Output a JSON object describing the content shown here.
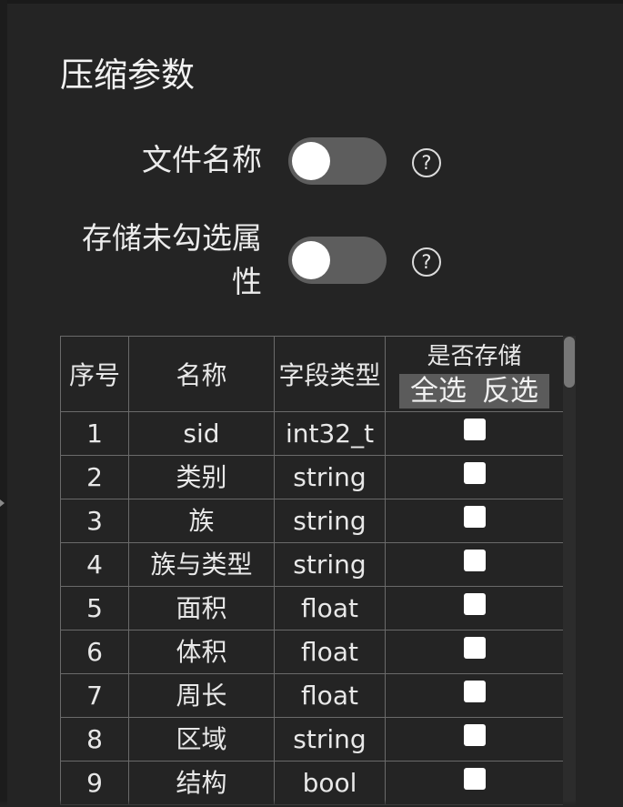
{
  "section": {
    "title": "压缩参数"
  },
  "settings": [
    {
      "label": "文件名称",
      "toggle": "off",
      "help": "?"
    },
    {
      "label": "存储未勾选属性",
      "toggle": "off",
      "help": "?"
    }
  ],
  "table": {
    "headers": {
      "index": "序号",
      "name": "名称",
      "type": "字段类型",
      "store": "是否存储",
      "select_all": "全选",
      "invert_select": "反选"
    },
    "rows": [
      {
        "index": "1",
        "name": "sid",
        "type": "int32_t",
        "checked": false
      },
      {
        "index": "2",
        "name": "类别",
        "type": "string",
        "checked": false
      },
      {
        "index": "3",
        "name": "族",
        "type": "string",
        "checked": false
      },
      {
        "index": "4",
        "name": "族与类型",
        "type": "string",
        "checked": false
      },
      {
        "index": "5",
        "name": "面积",
        "type": "float",
        "checked": false
      },
      {
        "index": "6",
        "name": "体积",
        "type": "float",
        "checked": false
      },
      {
        "index": "7",
        "name": "周长",
        "type": "float",
        "checked": false
      },
      {
        "index": "8",
        "name": "区域",
        "type": "string",
        "checked": false
      },
      {
        "index": "9",
        "name": "结构",
        "type": "bool",
        "checked": false
      }
    ]
  },
  "colors": {
    "background": "#242424",
    "toggle_track": "#5d5d5d",
    "toggle_knob": "#ffffff",
    "table_border": "#6a6a6a",
    "select_buttons_bg": "#5b5b5b"
  },
  "icons": [
    "question-circle-icon"
  ]
}
